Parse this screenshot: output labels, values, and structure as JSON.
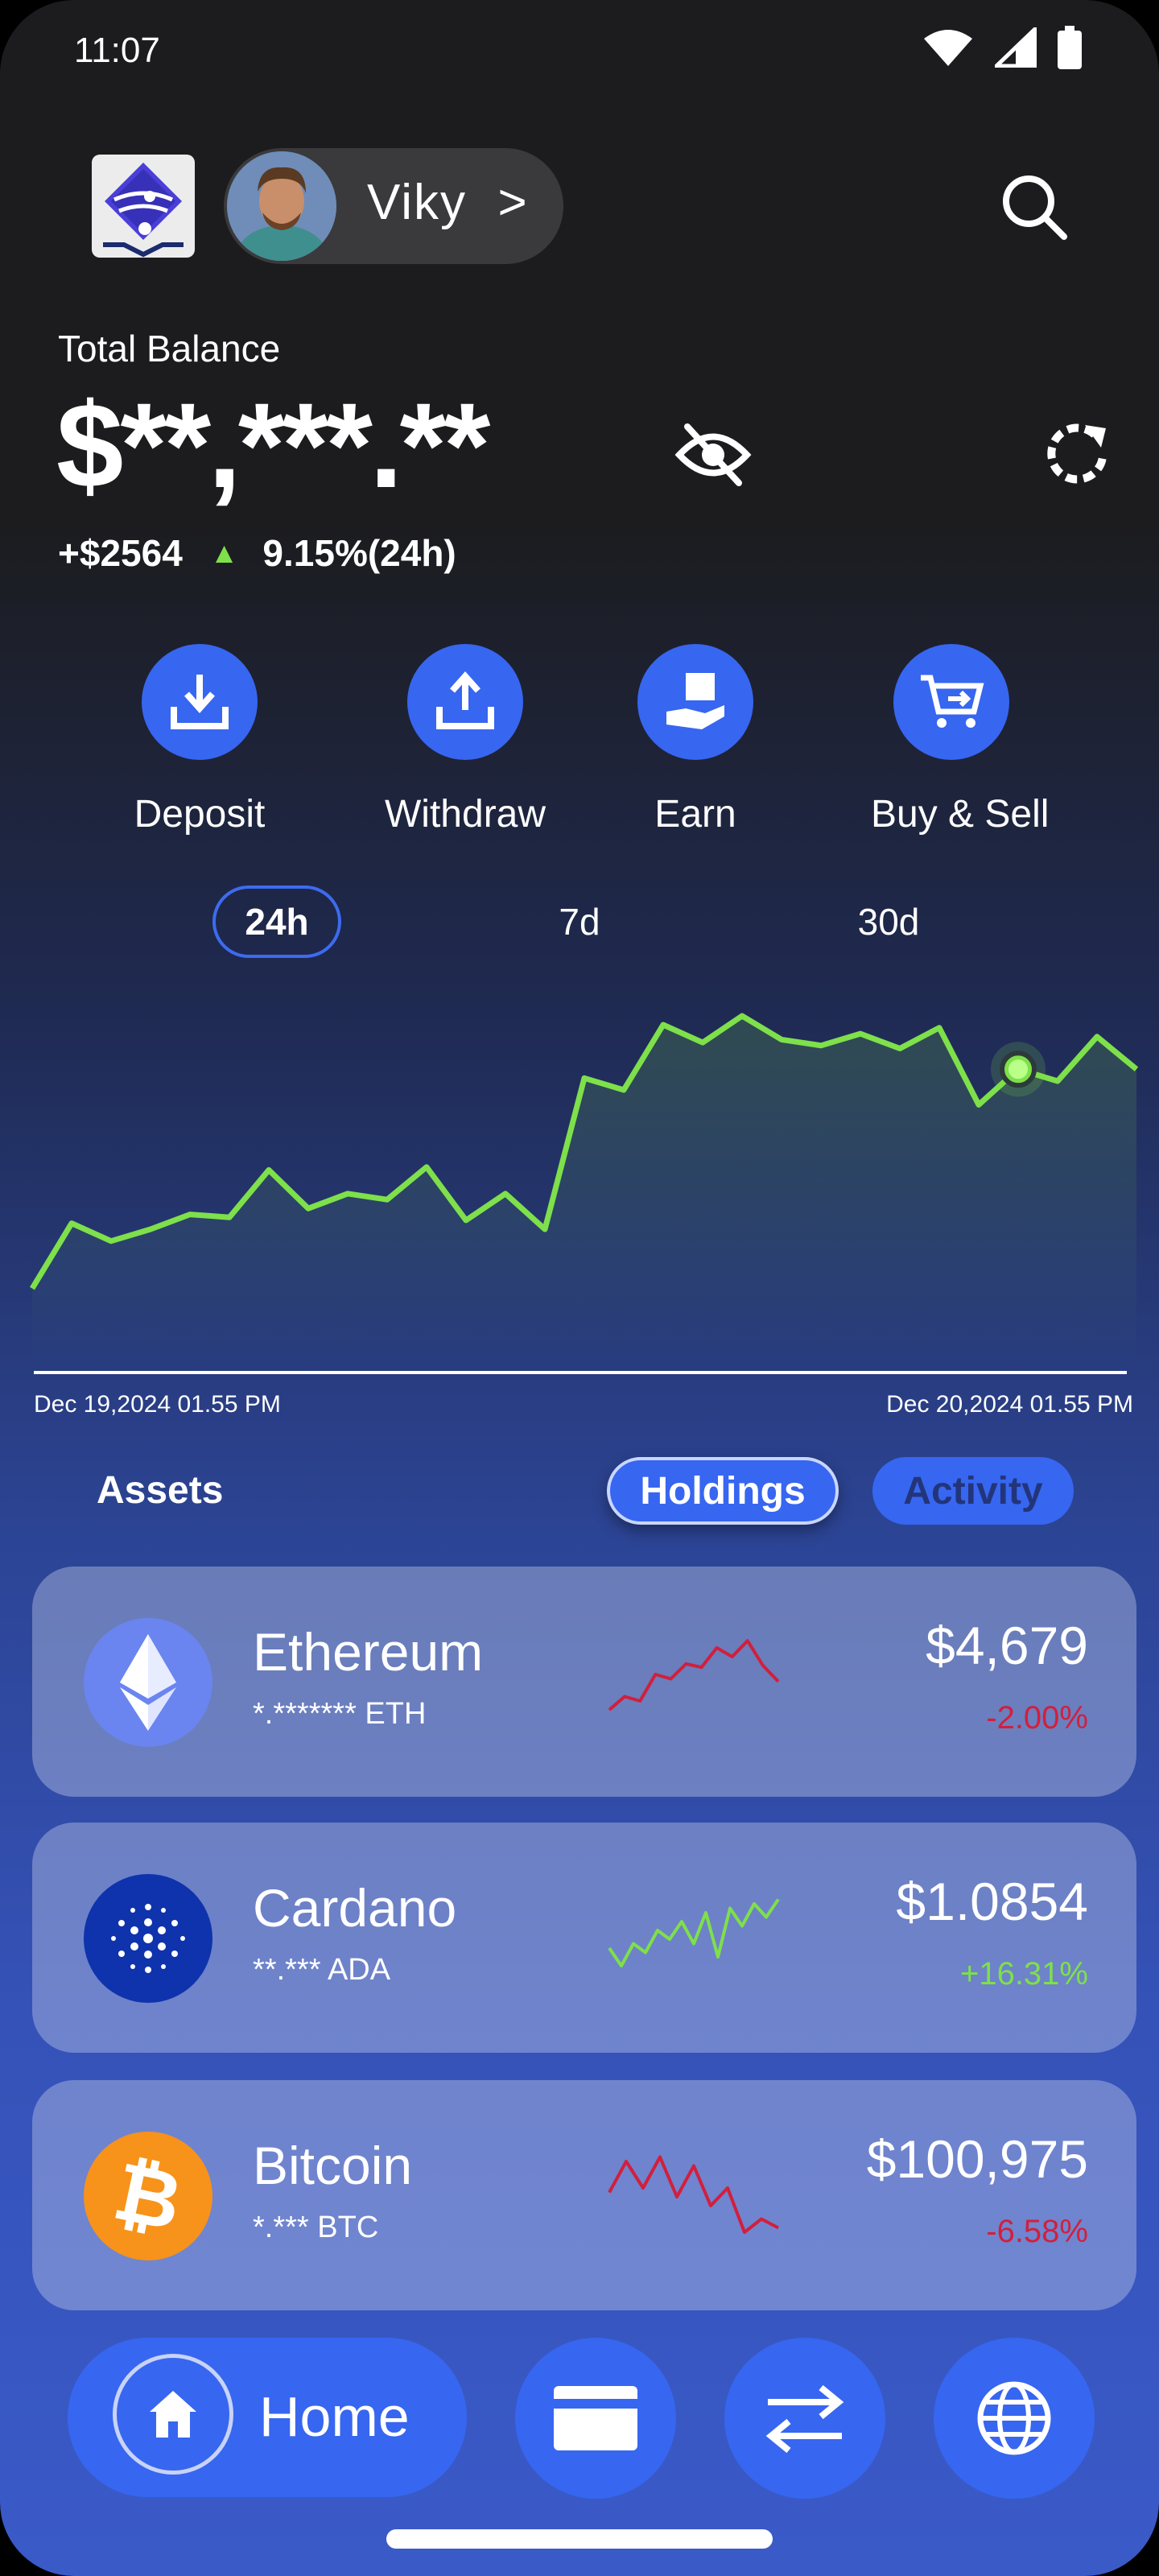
{
  "status": {
    "time": "11:07"
  },
  "header": {
    "user_name": "Viky",
    "chevron": ">"
  },
  "balance": {
    "label": "Total Balance",
    "value": "$**,***.**",
    "change_amount": "+$2564",
    "change_pct": "9.15%(24h)",
    "trend": "up"
  },
  "actions": [
    {
      "label": "Deposit",
      "icon": "download-tray-icon"
    },
    {
      "label": "Withdraw",
      "icon": "upload-tray-icon"
    },
    {
      "label": "Earn",
      "icon": "hand-receive-icon"
    },
    {
      "label": "Buy & Sell",
      "icon": "cart-icon"
    }
  ],
  "ranges": {
    "items": [
      "24h",
      "7d",
      "30d"
    ],
    "selected": "24h"
  },
  "chart": {
    "start_label": "Dec 19,2024 01.55 PM",
    "end_label": "Dec 20,2024 01.55 PM",
    "line_color": "#7ee04a"
  },
  "chart_data": {
    "type": "line",
    "title": "",
    "xlabel": "",
    "ylabel": "",
    "x_range": [
      "Dec 19,2024 01.55 PM",
      "Dec 20,2024 01.55 PM"
    ],
    "values": [
      8,
      30,
      24,
      28,
      33,
      32,
      48,
      35,
      40,
      38,
      49,
      31,
      40,
      28,
      79,
      75,
      97,
      91,
      100,
      92,
      90,
      94,
      89,
      96,
      70,
      82,
      78,
      93,
      82
    ],
    "highlight_index": 25,
    "grid": false
  },
  "assets": {
    "title": "Assets",
    "tabs": {
      "holdings": "Holdings",
      "activity": "Activity"
    },
    "items": [
      {
        "name": "Ethereum",
        "holding": "*.******* ETH",
        "price": "$4,679",
        "change": "-2.00%",
        "direction": "down",
        "icon": "ethereum-icon",
        "icon_bg": "#6a85f0",
        "spark": [
          20,
          35,
          30,
          60,
          55,
          72,
          68,
          90,
          80,
          98,
          70,
          52
        ]
      },
      {
        "name": "Cardano",
        "holding": "**.*** ADA",
        "price": "$1.0854",
        "change": "+16.31%",
        "direction": "up",
        "icon": "cardano-icon",
        "icon_bg": "#0f33ad",
        "spark": [
          40,
          20,
          45,
          35,
          60,
          50,
          70,
          45,
          80,
          30,
          85,
          65,
          90,
          75,
          95
        ]
      },
      {
        "name": "Bitcoin",
        "holding": "*.*** BTC",
        "price": "$100,975",
        "change": "-6.58%",
        "direction": "down",
        "icon": "bitcoin-icon",
        "icon_bg": "#f7931a",
        "spark": [
          55,
          90,
          60,
          95,
          50,
          85,
          40,
          60,
          10,
          25,
          15
        ]
      }
    ]
  },
  "colors": {
    "up": "#7ee04a",
    "down": "#d21f3c",
    "accent": "#3766f0"
  },
  "nav": {
    "home_label": "Home"
  }
}
